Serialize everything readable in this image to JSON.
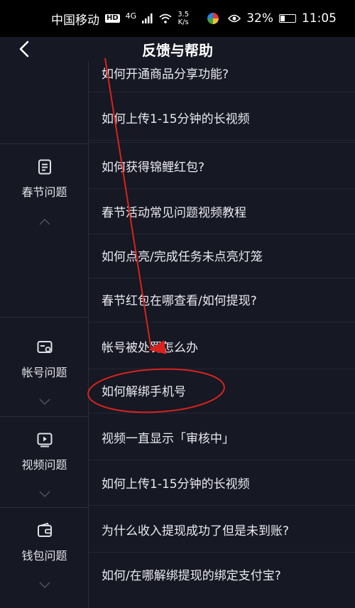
{
  "status_bar": {
    "carrier": "中国移动",
    "hd": "HD",
    "net": "4G",
    "speed_value": "3.5",
    "speed_unit": "K/s",
    "battery": "32%",
    "time": "11:05"
  },
  "header": {
    "title": "反馈与帮助"
  },
  "categories": [
    {
      "label": "春节问题",
      "icon": "document-icon"
    },
    {
      "label": "帐号问题",
      "icon": "account-card-icon"
    },
    {
      "label": "视频问题",
      "icon": "video-play-icon"
    },
    {
      "label": "钱包问题",
      "icon": "wallet-icon"
    }
  ],
  "questions": [
    "如何开通商品分享功能?",
    "如何上传1-15分钟的长视频",
    "如何获得锦鲤红包?",
    "春节活动常见问题视频教程",
    "如何点亮/完成任务未点亮灯笼",
    "春节红包在哪查看/如何提现?",
    "帐号被处罚怎么办",
    "如何解绑手机号",
    "视频一直显示「审核中」",
    "如何上传1-15分钟的长视频",
    "为什么收入提现成功了但是未到账?",
    "如何/在哪解绑提现的绑定支付宝?"
  ],
  "annotation_color": "#d9231c"
}
